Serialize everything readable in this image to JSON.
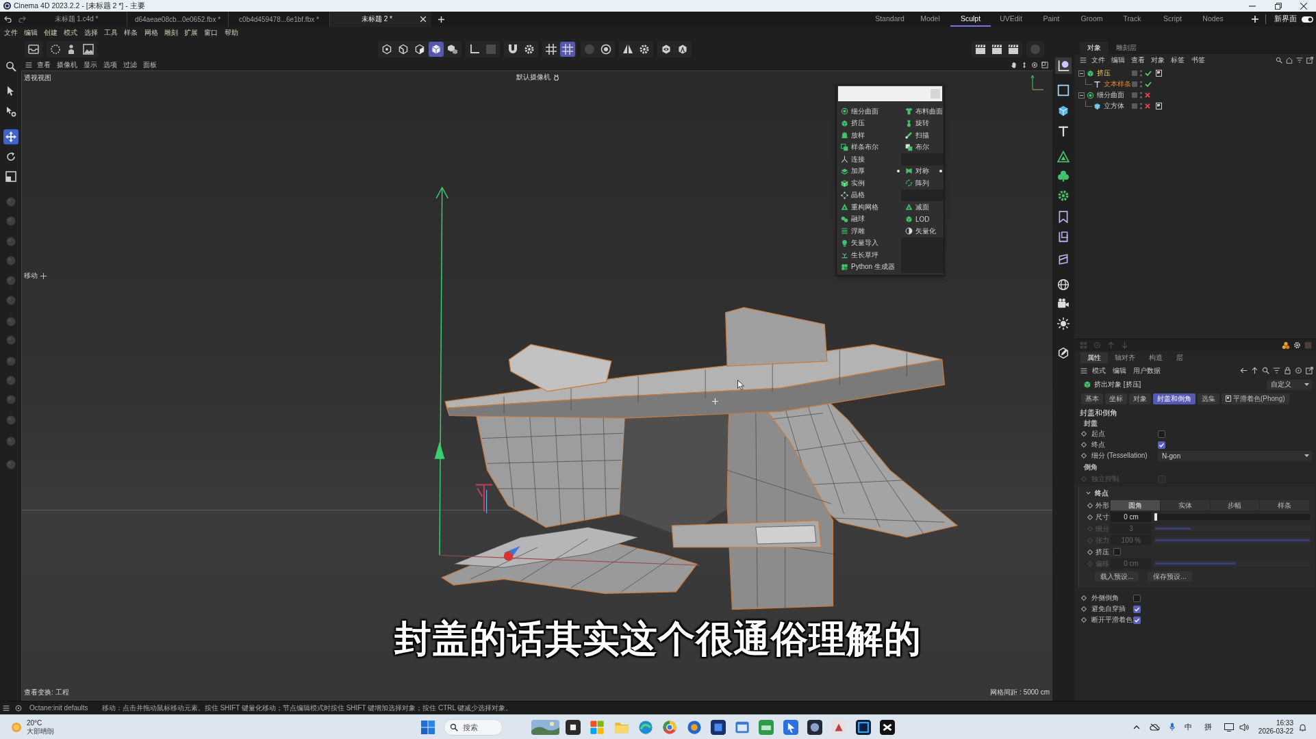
{
  "window": {
    "title": "Cinema 4D 2023.2.2 - [未标题 2 *] - 主要"
  },
  "document_tabs": [
    {
      "label": "未标题 1.c4d *",
      "selected": false
    },
    {
      "label": "d64aeae08cb...0e0652.fbx *",
      "selected": false
    },
    {
      "label": "c0b4d459478...6e1bf.fbx *",
      "selected": false
    },
    {
      "label": "未标题 2 *",
      "selected": true
    }
  ],
  "layouts": [
    {
      "label": "Standard",
      "selected": false
    },
    {
      "label": "Model",
      "selected": false
    },
    {
      "label": "Sculpt",
      "selected": true
    },
    {
      "label": "UVEdit",
      "selected": false
    },
    {
      "label": "Paint",
      "selected": false
    },
    {
      "label": "Groom",
      "selected": false
    },
    {
      "label": "Track",
      "selected": false
    },
    {
      "label": "Script",
      "selected": false
    },
    {
      "label": "Nodes",
      "selected": false
    }
  ],
  "new_ui": {
    "label": "新界面",
    "on": true
  },
  "menu": [
    "文件",
    "编辑",
    "创建",
    "模式",
    "选择",
    "工具",
    "样条",
    "网格",
    "雕刻",
    "扩展",
    "窗口",
    "帮助"
  ],
  "toolbar": {
    "left": [
      [
        {
          "selected": false
        }
      ],
      [
        {
          "selected": false
        },
        {
          "selected": false
        },
        {
          "selected": false
        }
      ]
    ],
    "center": [
      [
        {
          "selected": false
        },
        {
          "selected": false
        },
        {
          "selected": false
        },
        {
          "selected": true
        },
        {
          "selected": false
        }
      ],
      [
        {
          "selected": false
        },
        {
          "selected": false
        }
      ],
      [
        {
          "selected": false
        },
        {
          "selected": false
        }
      ],
      [
        {
          "selected": false
        },
        {
          "selected": true
        }
      ],
      [
        {
          "selected": false
        },
        {
          "selected": false
        }
      ],
      [
        {
          "selected": false
        },
        {
          "selected": false
        }
      ],
      [
        {
          "selected": false
        },
        {
          "selected": false
        }
      ]
    ],
    "right": [
      [
        {
          "selected": false
        },
        {
          "selected": false
        },
        {
          "selected": false
        }
      ],
      [
        {
          "selected": false
        }
      ]
    ]
  },
  "left_tools": [
    {
      "selected": false,
      "disabled": false
    },
    {
      "selected": false,
      "disabled": false
    },
    {
      "selected": false,
      "disabled": false
    },
    {
      "selected": true,
      "disabled": false
    },
    {
      "selected": false,
      "disabled": false
    },
    {
      "selected": false,
      "disabled": false
    },
    {
      "selected": false,
      "disabled": true
    },
    {
      "selected": false,
      "disabled": true
    },
    {
      "selected": false,
      "disabled": true
    },
    {
      "selected": false,
      "disabled": true
    },
    {
      "selected": false,
      "disabled": true
    },
    {
      "selected": false,
      "disabled": true
    },
    {
      "selected": false,
      "disabled": true
    },
    {
      "selected": false,
      "disabled": true
    },
    {
      "selected": false,
      "disabled": true
    },
    {
      "selected": false,
      "disabled": true
    },
    {
      "selected": false,
      "disabled": true
    },
    {
      "selected": false,
      "disabled": true
    },
    {
      "selected": false,
      "disabled": true
    },
    {
      "selected": false,
      "disabled": true
    }
  ],
  "viewport": {
    "menu": [
      "查看",
      "摄像机",
      "显示",
      "选项",
      "过滤",
      "面板"
    ],
    "view_name": "透视视图",
    "camera": "默认摄像机",
    "tool_label": "移动",
    "transform_info": "查看变换: 工程",
    "grid_info": "网格间距 : 5000 cm",
    "create_menu": {
      "left_column": [
        {
          "label": "细分曲面",
          "marked": false
        },
        {
          "label": "挤压",
          "marked": false
        },
        {
          "label": "放样",
          "marked": false
        },
        {
          "label": "样条布尔",
          "marked": false
        },
        {
          "label": "连接",
          "marked": false
        },
        {
          "label": "加厚",
          "marked": true
        },
        {
          "label": "实例",
          "marked": false
        },
        {
          "label": "晶格",
          "marked": false
        },
        {
          "label": "重构网格",
          "marked": false
        },
        {
          "label": "融球",
          "marked": false
        },
        {
          "label": "浮雕",
          "marked": false
        },
        {
          "label": "矢量导入",
          "marked": false
        },
        {
          "label": "生长草坪",
          "marked": false
        },
        {
          "label": "Python 生成器",
          "marked": false
        }
      ],
      "right_column": [
        {
          "kind": "item",
          "label": "布料曲面",
          "marked": false
        },
        {
          "kind": "item",
          "label": "旋转",
          "marked": false
        },
        {
          "kind": "item",
          "label": "扫描",
          "marked": false
        },
        {
          "kind": "item",
          "label": "布尔",
          "marked": false
        },
        {
          "kind": "gap"
        },
        {
          "kind": "item",
          "label": "对称",
          "marked": true
        },
        {
          "kind": "item",
          "label": "阵列",
          "marked": false
        },
        {
          "kind": "gap"
        },
        {
          "kind": "item",
          "label": "减面",
          "marked": false
        },
        {
          "kind": "item",
          "label": "LOD",
          "marked": false
        },
        {
          "kind": "item",
          "label": "矢量化",
          "marked": false
        },
        {
          "kind": "gap"
        },
        {
          "kind": "gap"
        },
        {
          "kind": "gap"
        }
      ]
    }
  },
  "subtitle": "封盖的话其实这个很通俗理解的",
  "right_tools": [
    {
      "selected": true
    },
    {
      "selected": false
    },
    {
      "selected": false
    },
    {
      "selected": false
    },
    {
      "selected": false
    },
    {
      "selected": false
    },
    {
      "selected": false
    },
    {
      "selected": false
    },
    {
      "selected": false
    },
    {
      "selected": false
    },
    {
      "selected": false
    },
    {
      "selected": false
    },
    {
      "selected": false
    },
    {
      "selected": false
    }
  ],
  "object_manager": {
    "tabs": [
      {
        "label": "对象",
        "selected": true
      },
      {
        "label": "雕刻层",
        "selected": false
      }
    ],
    "menu": [
      "文件",
      "编辑",
      "查看",
      "对象",
      "标签",
      "书签"
    ],
    "objects": [
      {
        "name": "挤压",
        "selected": true,
        "active": true,
        "enabled": true,
        "tagged": true,
        "expanded": true,
        "children": [
          {
            "name": "文本样条",
            "selected": true,
            "active": false,
            "enabled": true,
            "tagged": false
          }
        ]
      },
      {
        "name": "细分曲面",
        "selected": false,
        "active": false,
        "enabled": false,
        "tagged": false,
        "expanded": true,
        "children": [
          {
            "name": "立方体",
            "selected": false,
            "active": false,
            "enabled": false,
            "tagged": true
          }
        ]
      }
    ]
  },
  "attributes": {
    "tabs": [
      {
        "label": "属性",
        "selected": true
      },
      {
        "label": "轴对齐",
        "selected": false
      },
      {
        "label": "构造",
        "selected": false
      },
      {
        "label": "层",
        "selected": false
      }
    ],
    "menu": [
      "模式",
      "编辑",
      "用户数据"
    ],
    "object_title": "挤出对象 [挤压]",
    "preset": "自定义",
    "section_tabs": [
      {
        "label": "基本",
        "selected": false,
        "kind": "plain"
      },
      {
        "label": "坐标",
        "selected": false,
        "kind": "plain"
      },
      {
        "label": "对象",
        "selected": false,
        "kind": "plain"
      },
      {
        "label": "封盖和倒角",
        "selected": true,
        "kind": "plain"
      },
      {
        "label": "选集",
        "selected": false,
        "kind": "plain"
      },
      {
        "label": "平滑着色(Phong)",
        "selected": false,
        "kind": "tag"
      }
    ],
    "section_title": "封盖和倒角",
    "groups": [
      {
        "title": "封盖",
        "rows": [
          {
            "kind": "checkbox",
            "label": "起点",
            "checked": false,
            "disabled": false
          },
          {
            "kind": "checkbox",
            "label": "终点",
            "checked": true,
            "disabled": false
          },
          {
            "kind": "dropdown",
            "label": "细分 (Tessellation)",
            "value": "N-gon",
            "disabled": false
          }
        ]
      },
      {
        "title": "倒角",
        "rows": [
          {
            "kind": "checkbox",
            "label": "独立控制",
            "checked": false,
            "disabled": true
          }
        ]
      }
    ],
    "end_group": {
      "title": "终点",
      "expanded": true,
      "rows": [
        {
          "kind": "segmented",
          "label": "外形",
          "disabled": false,
          "options": [
            {
              "label": "圆角",
              "selected": true
            },
            {
              "label": "实体",
              "selected": false
            },
            {
              "label": "步幅",
              "selected": false
            },
            {
              "label": "样条",
              "selected": false
            }
          ]
        },
        {
          "kind": "slider",
          "label": "尺寸",
          "value": "0 cm",
          "level": 0,
          "disabled": false
        },
        {
          "kind": "slider",
          "label": "细分",
          "value": "3",
          "level": 0.23,
          "disabled": true
        },
        {
          "kind": "slider",
          "label": "张力",
          "value": "100 %",
          "level": 1,
          "disabled": true
        },
        {
          "kind": "checkbox",
          "label": "挤压",
          "checked": false,
          "disabled": false
        },
        {
          "kind": "slider",
          "label": "偏移",
          "value": "0 cm",
          "level": 0.52,
          "disabled": true
        }
      ],
      "buttons": [
        "载入预设...",
        "保存预设..."
      ]
    },
    "options": [
      {
        "kind": "checkbox",
        "label": "外侧倒角",
        "checked": false,
        "disabled": false
      },
      {
        "kind": "checkbox",
        "label": "避免自穿插",
        "checked": true,
        "disabled": false
      },
      {
        "kind": "checkbox",
        "label": "断开平滑着色",
        "checked": true,
        "disabled": false
      }
    ]
  },
  "status_bar": {
    "plugin": "Octane:init defaults",
    "message": "移动：点击并拖动鼠标移动元素。按住 SHIFT 键量化移动；节点编辑模式时按住 SHIFT 键增加选择对象；按住 CTRL 键减少选择对象。"
  },
  "taskbar": {
    "temperature": "20°C",
    "weather": "大部晴朗",
    "search_placeholder": "搜索",
    "input_language": "中",
    "input_mode": "拼",
    "time": "16:33",
    "date": "2026-03-22"
  }
}
